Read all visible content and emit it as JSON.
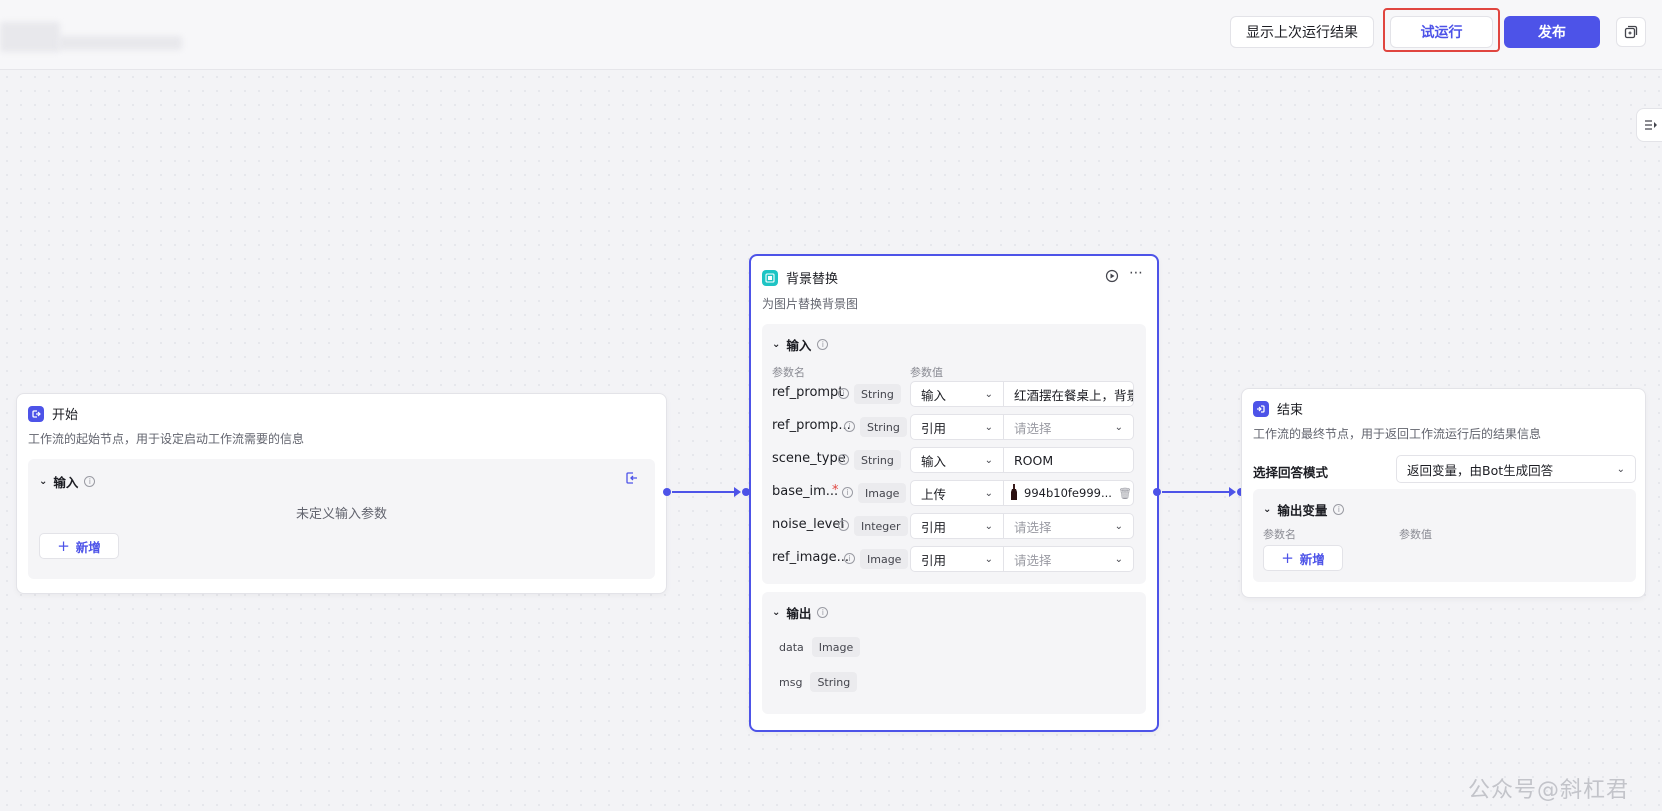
{
  "toolbar": {
    "show_last_result": "显示上次运行结果",
    "trial_run": "试运行",
    "publish": "发布"
  },
  "colors": {
    "accent": "#4d53e8",
    "highlight": "#e0453f"
  },
  "start_node": {
    "title": "开始",
    "description": "工作流的起始节点，用于设定启动工作流需要的信息",
    "input_section": "输入",
    "empty_text": "未定义输入参数",
    "add_label": "新增"
  },
  "bg_node": {
    "title": "背景替换",
    "description": "为图片替换背景图",
    "input_section": "输入",
    "col_name": "参数名",
    "col_value": "参数值",
    "params": [
      {
        "name": "ref_prompt",
        "type": "String",
        "mode": "输入",
        "value": "红酒摆在餐桌上，背景",
        "placeholder": ""
      },
      {
        "name": "ref_promp...",
        "type": "String",
        "mode": "引用",
        "value": "",
        "placeholder": "请选择"
      },
      {
        "name": "scene_type",
        "type": "String",
        "mode": "输入",
        "value": "ROOM",
        "placeholder": ""
      },
      {
        "name": "base_im...",
        "type": "Image",
        "mode": "上传",
        "value": "994b10fe999...",
        "placeholder": ""
      },
      {
        "name": "noise_level",
        "type": "Integer",
        "mode": "引用",
        "value": "",
        "placeholder": "请选择"
      },
      {
        "name": "ref_image...",
        "type": "Image",
        "mode": "引用",
        "value": "",
        "placeholder": "请选择"
      }
    ],
    "output_section": "输出",
    "outputs": [
      {
        "name": "data",
        "type": "Image"
      },
      {
        "name": "msg",
        "type": "String"
      }
    ]
  },
  "end_node": {
    "title": "结束",
    "description": "工作流的最终节点，用于返回工作流运行后的结果信息",
    "answer_mode_label": "选择回答模式",
    "answer_mode_value": "返回变量，由Bot生成回答",
    "output_section": "输出变量",
    "col_name": "参数名",
    "col_value": "参数值",
    "add_label": "新增"
  },
  "watermark": "公众号@斜杠君"
}
